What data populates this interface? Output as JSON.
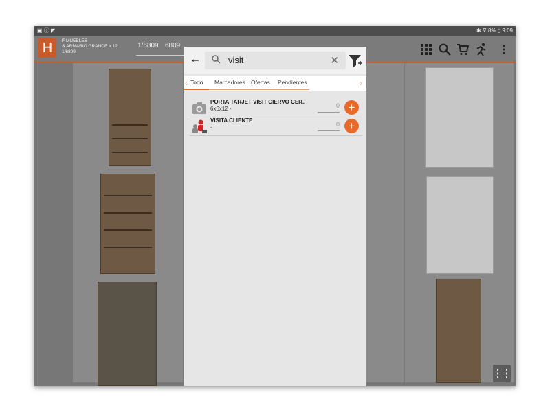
{
  "statusbar": {
    "left_icons": "▣ ⓢ ◤",
    "right": "✱ ⊽ 8% ▯ 9:09"
  },
  "header": {
    "logo_letter": "H",
    "family_code": "F",
    "family_name": "MUEBLES",
    "sub_code": "S",
    "sub_name": "ARMARIO GRANDE > 12",
    "position_small": "1/6809",
    "position": "1/6809",
    "total": "6809",
    "icons": [
      "grid-icon",
      "search-icon",
      "cart-icon",
      "runner-icon",
      "more-icon"
    ]
  },
  "search": {
    "back_symbol": "←",
    "icon_symbol": "🔍",
    "value": "visit",
    "clear_symbol": "✕"
  },
  "tabs": [
    {
      "label": "Todo",
      "active": true
    },
    {
      "label": "Marcadores",
      "active": false
    },
    {
      "label": "Ofertas",
      "active": false
    },
    {
      "label": "Pendientes",
      "active": false
    }
  ],
  "results": [
    {
      "name": "PORTA TARJET VISIT CIERVO CER..",
      "sub": "6x6x12 -",
      "qty": "0",
      "thumb": "camera-icon"
    },
    {
      "name": "VISITA CLIENTE",
      "sub": "-",
      "qty": "0",
      "thumb": "visit-client-icon"
    }
  ],
  "colors": {
    "accent": "#e8692a",
    "logo": "#c95a2a"
  }
}
